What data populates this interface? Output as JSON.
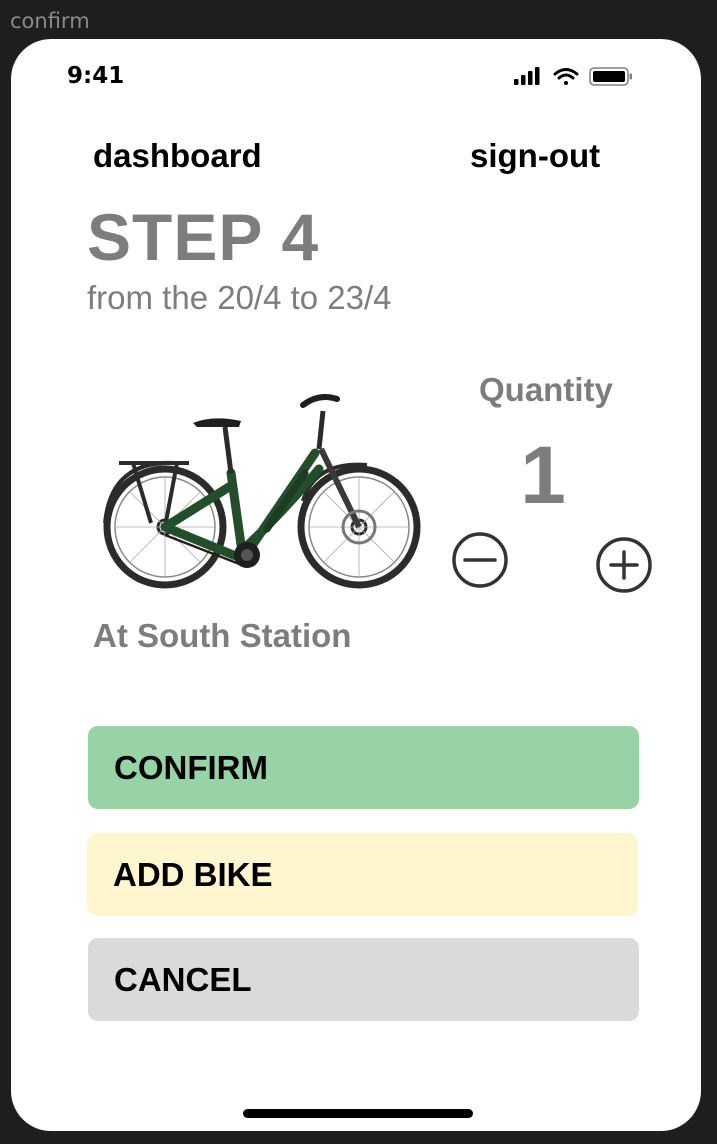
{
  "frame": {
    "label": "confirm"
  },
  "status_bar": {
    "time": "9:41",
    "icons": [
      "signal-icon",
      "wifi-icon",
      "battery-icon"
    ]
  },
  "nav": {
    "dashboard": "dashboard",
    "sign_out": "sign-out"
  },
  "header": {
    "title": "STEP 4",
    "subtitle": "from the 20/4 to 23/4"
  },
  "product": {
    "image": "bike-image",
    "location": "At South Station"
  },
  "quantity": {
    "label": "Quantity",
    "value": "1",
    "decrement_icon": "minus-circle-icon",
    "increment_icon": "plus-circle-icon"
  },
  "actions": {
    "confirm": "CONFIRM",
    "add_bike": "ADD BIKE",
    "cancel": "CANCEL"
  },
  "colors": {
    "confirm": "#98d3a7",
    "add_bike": "#fff6cf",
    "cancel": "#dadada",
    "muted_text": "#7d7d7d",
    "bike_frame": "#234d2b"
  }
}
